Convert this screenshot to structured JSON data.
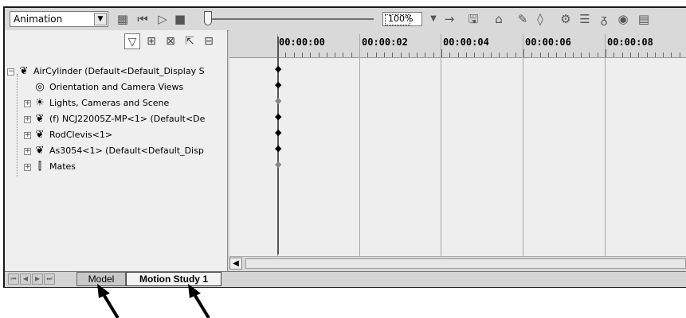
{
  "toolbar": {
    "study_type": "Animation",
    "zoom_value": "100%",
    "icons": [
      "calculate-icon",
      "play-from-start-icon",
      "play-icon",
      "stop-icon",
      "arrow-icon",
      "save-icon",
      "wizard-icon",
      "autokey-icon",
      "add-key-icon",
      "motor-icon",
      "spring-icon",
      "contact-icon",
      "gravity-icon",
      "results-icon"
    ]
  },
  "filters": [
    "filter-animation-icon",
    "filter-driving-icon",
    "filter-selected-icon",
    "filter-results-icon"
  ],
  "tree": {
    "root": "AirCylinder  (Default<Default_Display S",
    "items": [
      "Orientation and Camera Views",
      "Lights, Cameras and Scene",
      "(f) NCJ22005Z-MP<1> (Default<De",
      "RodClevis<1>",
      "As3054<1> (Default<Default_Disp",
      "Mates"
    ]
  },
  "timeline": {
    "labels": [
      "00:00:00",
      "00:00:02",
      "00:00:04",
      "00:00:06",
      "00:00:08"
    ]
  },
  "tabs": {
    "model": "Model",
    "motion_study": "Motion Study 1"
  }
}
